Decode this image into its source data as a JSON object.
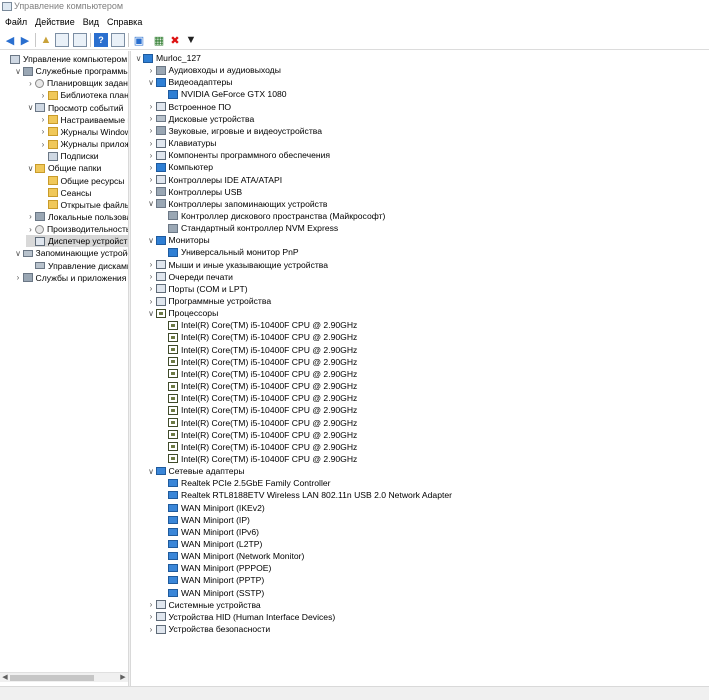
{
  "window": {
    "title": "Управление компьютером"
  },
  "menu": [
    "Файл",
    "Действие",
    "Вид",
    "Справка"
  ],
  "toolbar": {
    "icons": [
      "back-icon",
      "forward-icon",
      "up-folder-icon",
      "console-tree-icon",
      "properties-icon",
      "help-icon",
      "show-hide-icon",
      "monitor-icon",
      "update-driver-icon",
      "uninstall-icon",
      "disable-icon"
    ]
  },
  "left_tree": [
    {
      "label": "Управление компьютером (л",
      "level": 0,
      "chevron": "",
      "icon": "sq"
    },
    {
      "label": "Служебные программы",
      "level": 1,
      "chevron": "v",
      "icon": "gen"
    },
    {
      "label": "Планировщик заданий",
      "level": 2,
      "chevron": ">",
      "icon": "clock"
    },
    {
      "label": "Библиотека планир",
      "level": 3,
      "chevron": ">",
      "icon": "folder"
    },
    {
      "label": "Просмотр событий",
      "level": 2,
      "chevron": "v",
      "icon": "sq"
    },
    {
      "label": "Настраиваемые пр",
      "level": 3,
      "chevron": ">",
      "icon": "folder"
    },
    {
      "label": "Журналы Windows",
      "level": 3,
      "chevron": ">",
      "icon": "folder"
    },
    {
      "label": "Журналы приложе",
      "level": 3,
      "chevron": ">",
      "icon": "folder"
    },
    {
      "label": "Подписки",
      "level": 3,
      "chevron": "",
      "icon": "sq"
    },
    {
      "label": "Общие папки",
      "level": 2,
      "chevron": "v",
      "icon": "folder"
    },
    {
      "label": "Общие ресурсы",
      "level": 3,
      "chevron": "",
      "icon": "folder"
    },
    {
      "label": "Сеансы",
      "level": 3,
      "chevron": "",
      "icon": "folder"
    },
    {
      "label": "Открытые файлы",
      "level": 3,
      "chevron": "",
      "icon": "folder"
    },
    {
      "label": "Локальные пользовате",
      "level": 2,
      "chevron": ">",
      "icon": "gen"
    },
    {
      "label": "Производительность",
      "level": 2,
      "chevron": ">",
      "icon": "clock"
    },
    {
      "label": "Диспетчер устройств",
      "level": 2,
      "chevron": "",
      "icon": "dev",
      "selected": true
    },
    {
      "label": "Запоминающие устройст",
      "level": 1,
      "chevron": "v",
      "icon": "disk"
    },
    {
      "label": "Управление дисками",
      "level": 2,
      "chevron": "",
      "icon": "disk"
    },
    {
      "label": "Службы и приложения",
      "level": 1,
      "chevron": ">",
      "icon": "gen"
    }
  ],
  "device_tree": [
    {
      "label": "Murloc_127",
      "level": 0,
      "chevron": "v",
      "icon": "mon"
    },
    {
      "label": "Аудиовходы и аудиовыходы",
      "level": 1,
      "chevron": ">",
      "icon": "gen"
    },
    {
      "label": "Видеоадаптеры",
      "level": 1,
      "chevron": "v",
      "icon": "mon"
    },
    {
      "label": "NVIDIA GeForce GTX 1080",
      "level": 2,
      "chevron": "",
      "icon": "mon"
    },
    {
      "label": "Встроенное ПО",
      "level": 1,
      "chevron": ">",
      "icon": "dev"
    },
    {
      "label": "Дисковые устройства",
      "level": 1,
      "chevron": ">",
      "icon": "disk"
    },
    {
      "label": "Звуковые, игровые и видеоустройства",
      "level": 1,
      "chevron": ">",
      "icon": "gen"
    },
    {
      "label": "Клавиатуры",
      "level": 1,
      "chevron": ">",
      "icon": "dev"
    },
    {
      "label": "Компоненты программного обеспечения",
      "level": 1,
      "chevron": ">",
      "icon": "dev"
    },
    {
      "label": "Компьютер",
      "level": 1,
      "chevron": ">",
      "icon": "mon"
    },
    {
      "label": "Контроллеры IDE ATA/ATAPI",
      "level": 1,
      "chevron": ">",
      "icon": "dev"
    },
    {
      "label": "Контроллеры USB",
      "level": 1,
      "chevron": ">",
      "icon": "gen"
    },
    {
      "label": "Контроллеры запоминающих устройств",
      "level": 1,
      "chevron": "v",
      "icon": "gen"
    },
    {
      "label": "Контроллер дискового пространства (Майкрософт)",
      "level": 2,
      "chevron": "",
      "icon": "gen"
    },
    {
      "label": "Стандартный контроллер NVM Express",
      "level": 2,
      "chevron": "",
      "icon": "gen"
    },
    {
      "label": "Мониторы",
      "level": 1,
      "chevron": "v",
      "icon": "mon"
    },
    {
      "label": "Универсальный монитор PnP",
      "level": 2,
      "chevron": "",
      "icon": "mon"
    },
    {
      "label": "Мыши и иные указывающие устройства",
      "level": 1,
      "chevron": ">",
      "icon": "dev"
    },
    {
      "label": "Очереди печати",
      "level": 1,
      "chevron": ">",
      "icon": "dev"
    },
    {
      "label": "Порты (COM и LPT)",
      "level": 1,
      "chevron": ">",
      "icon": "dev"
    },
    {
      "label": "Программные устройства",
      "level": 1,
      "chevron": ">",
      "icon": "dev"
    },
    {
      "label": "Процессоры",
      "level": 1,
      "chevron": "v",
      "icon": "cpu"
    },
    {
      "label": "Intel(R) Core(TM) i5-10400F CPU @ 2.90GHz",
      "level": 2,
      "chevron": "",
      "icon": "cpu"
    },
    {
      "label": "Intel(R) Core(TM) i5-10400F CPU @ 2.90GHz",
      "level": 2,
      "chevron": "",
      "icon": "cpu"
    },
    {
      "label": "Intel(R) Core(TM) i5-10400F CPU @ 2.90GHz",
      "level": 2,
      "chevron": "",
      "icon": "cpu"
    },
    {
      "label": "Intel(R) Core(TM) i5-10400F CPU @ 2.90GHz",
      "level": 2,
      "chevron": "",
      "icon": "cpu"
    },
    {
      "label": "Intel(R) Core(TM) i5-10400F CPU @ 2.90GHz",
      "level": 2,
      "chevron": "",
      "icon": "cpu"
    },
    {
      "label": "Intel(R) Core(TM) i5-10400F CPU @ 2.90GHz",
      "level": 2,
      "chevron": "",
      "icon": "cpu"
    },
    {
      "label": "Intel(R) Core(TM) i5-10400F CPU @ 2.90GHz",
      "level": 2,
      "chevron": "",
      "icon": "cpu"
    },
    {
      "label": "Intel(R) Core(TM) i5-10400F CPU @ 2.90GHz",
      "level": 2,
      "chevron": "",
      "icon": "cpu"
    },
    {
      "label": "Intel(R) Core(TM) i5-10400F CPU @ 2.90GHz",
      "level": 2,
      "chevron": "",
      "icon": "cpu"
    },
    {
      "label": "Intel(R) Core(TM) i5-10400F CPU @ 2.90GHz",
      "level": 2,
      "chevron": "",
      "icon": "cpu"
    },
    {
      "label": "Intel(R) Core(TM) i5-10400F CPU @ 2.90GHz",
      "level": 2,
      "chevron": "",
      "icon": "cpu"
    },
    {
      "label": "Intel(R) Core(TM) i5-10400F CPU @ 2.90GHz",
      "level": 2,
      "chevron": "",
      "icon": "cpu"
    },
    {
      "label": "Сетевые адаптеры",
      "level": 1,
      "chevron": "v",
      "icon": "net"
    },
    {
      "label": "Realtek PCIe 2.5GbE Family Controller",
      "level": 2,
      "chevron": "",
      "icon": "net"
    },
    {
      "label": "Realtek RTL8188ETV Wireless LAN 802.11n USB 2.0 Network Adapter",
      "level": 2,
      "chevron": "",
      "icon": "net"
    },
    {
      "label": "WAN Miniport (IKEv2)",
      "level": 2,
      "chevron": "",
      "icon": "net"
    },
    {
      "label": "WAN Miniport (IP)",
      "level": 2,
      "chevron": "",
      "icon": "net"
    },
    {
      "label": "WAN Miniport (IPv6)",
      "level": 2,
      "chevron": "",
      "icon": "net"
    },
    {
      "label": "WAN Miniport (L2TP)",
      "level": 2,
      "chevron": "",
      "icon": "net"
    },
    {
      "label": "WAN Miniport (Network Monitor)",
      "level": 2,
      "chevron": "",
      "icon": "net"
    },
    {
      "label": "WAN Miniport (PPPOE)",
      "level": 2,
      "chevron": "",
      "icon": "net"
    },
    {
      "label": "WAN Miniport (PPTP)",
      "level": 2,
      "chevron": "",
      "icon": "net"
    },
    {
      "label": "WAN Miniport (SSTP)",
      "level": 2,
      "chevron": "",
      "icon": "net"
    },
    {
      "label": "Системные устройства",
      "level": 1,
      "chevron": ">",
      "icon": "dev"
    },
    {
      "label": "Устройства HID (Human Interface Devices)",
      "level": 1,
      "chevron": ">",
      "icon": "dev"
    },
    {
      "label": "Устройства безопасности",
      "level": 1,
      "chevron": ">",
      "icon": "dev"
    }
  ]
}
